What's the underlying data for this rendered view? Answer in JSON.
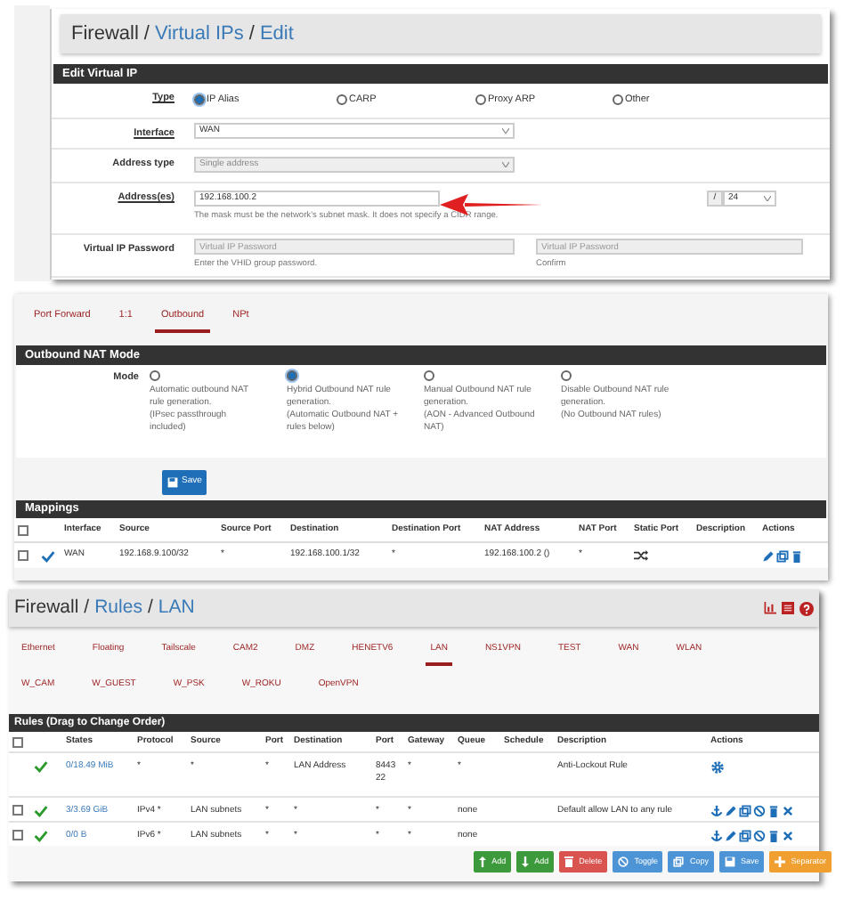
{
  "vip_edit": {
    "breadcrumb": [
      "Firewall",
      "Virtual IPs",
      "Edit"
    ],
    "breadcrumb_separator": "/",
    "section": "Edit Virtual IP",
    "type": {
      "label": "Type",
      "options": [
        {
          "label": "IP Alias",
          "selected": true
        },
        {
          "label": "CARP",
          "selected": false
        },
        {
          "label": "Proxy ARP",
          "selected": false
        },
        {
          "label": "Other",
          "selected": false
        }
      ]
    },
    "interface": {
      "label": "Interface",
      "value": "WAN"
    },
    "address_type": {
      "label": "Address type",
      "value": "Single address",
      "disabled": true
    },
    "addresses": {
      "label": "Address(es)",
      "value": "192.168.100.2",
      "separator": "/",
      "mask": "24",
      "hint": "The mask must be the network's subnet mask. It does not specify a CIDR range."
    },
    "vip_password": {
      "label": "Virtual IP Password",
      "placeholder": "Virtual IP Password",
      "hint": "Enter the VHID group password.",
      "confirm_placeholder": "Virtual IP Password",
      "confirm_hint": "Confirm"
    }
  },
  "nat_outbound": {
    "tabs": [
      {
        "label": "Port Forward",
        "selected": false
      },
      {
        "label": "1:1",
        "selected": false
      },
      {
        "label": "Outbound",
        "selected": true
      },
      {
        "label": "NPt",
        "selected": false
      }
    ],
    "mode_section": "Outbound NAT Mode",
    "mode_label": "Mode",
    "modes": [
      {
        "selected": false,
        "lines": [
          "Automatic outbound NAT rule generation.",
          "(IPsec passthrough included)"
        ]
      },
      {
        "selected": true,
        "lines": [
          "Hybrid Outbound NAT rule generation.",
          "(Automatic Outbound NAT + rules below)"
        ]
      },
      {
        "selected": false,
        "lines": [
          "Manual Outbound NAT rule generation.",
          "(AON - Advanced Outbound NAT)"
        ]
      },
      {
        "selected": false,
        "lines": [
          "Disable Outbound NAT rule generation.",
          "(No Outbound NAT rules)"
        ]
      }
    ],
    "save_button": "Save",
    "mappings_section": "Mappings",
    "select_all_checked": false,
    "columns": [
      "Interface",
      "Source",
      "Source Port",
      "Destination",
      "Destination Port",
      "NAT Address",
      "NAT Port",
      "Static Port",
      "Description",
      "Actions"
    ],
    "rows": [
      {
        "checked": false,
        "enabled": true,
        "interface": "WAN",
        "source": "192.168.9.100/32",
        "source_port": "*",
        "destination": "192.168.100.1/32",
        "destination_port": "*",
        "nat_address": "192.168.100.2 ()",
        "nat_port": "*",
        "static_port": true,
        "actions": [
          {
            "kind": "edit"
          },
          {
            "kind": "copy"
          },
          {
            "kind": "delete"
          }
        ]
      }
    ]
  },
  "rules_lan": {
    "breadcrumb": [
      "Firewall",
      "Rules",
      "LAN"
    ],
    "breadcrumb_separator": "/",
    "tabs": [
      {
        "label": "Ethernet",
        "selected": false
      },
      {
        "label": "Floating",
        "selected": false
      },
      {
        "label": "Tailscale",
        "selected": false
      },
      {
        "label": "CAM2",
        "selected": false
      },
      {
        "label": "DMZ",
        "selected": false
      },
      {
        "label": "HENETV6",
        "selected": false
      },
      {
        "label": "LAN",
        "selected": true
      },
      {
        "label": "NS1VPN",
        "selected": false
      },
      {
        "label": "TEST",
        "selected": false
      },
      {
        "label": "WAN",
        "selected": false
      },
      {
        "label": "WLAN",
        "selected": false
      },
      {
        "label": "W_CAM",
        "selected": false
      },
      {
        "label": "W_GUEST",
        "selected": false
      },
      {
        "label": "W_PSK",
        "selected": false
      },
      {
        "label": "W_ROKU",
        "selected": false
      },
      {
        "label": "OpenVPN",
        "selected": false
      }
    ],
    "section": "Rules (Drag to Change Order)",
    "select_all_checked": false,
    "columns": [
      "States",
      "Protocol",
      "Source",
      "Port",
      "Destination",
      "Port",
      "Gateway",
      "Queue",
      "Schedule",
      "Description",
      "Actions"
    ],
    "rows": [
      {
        "has_checkbox": false,
        "enabled": true,
        "states": "0/18.49 MiB",
        "protocol": "*",
        "source": "*",
        "source_port": "*",
        "destination": "LAN Address",
        "destination_port": "8443 22",
        "gateway": "*",
        "queue": "*",
        "description": "Anti-Lockout Rule",
        "actions": [
          {
            "kind": "settings"
          }
        ]
      },
      {
        "has_checkbox": true,
        "enabled": true,
        "states": "3/3.69 GiB",
        "protocol": "IPv4 *",
        "source": "LAN subnets",
        "source_port": "*",
        "destination": "*",
        "destination_port": "*",
        "gateway": "*",
        "queue": "none",
        "description": "Default allow LAN to any rule",
        "actions": [
          {
            "kind": "anchor"
          },
          {
            "kind": "edit"
          },
          {
            "kind": "copy"
          },
          {
            "kind": "block"
          },
          {
            "kind": "delete"
          },
          {
            "kind": "close"
          }
        ]
      },
      {
        "has_checkbox": true,
        "enabled": true,
        "states": "0/0 B",
        "protocol": "IPv6 *",
        "source": "LAN subnets",
        "source_port": "*",
        "destination": "*",
        "destination_port": "*",
        "gateway": "*",
        "queue": "none",
        "actions": [
          {
            "kind": "anchor"
          },
          {
            "kind": "edit"
          },
          {
            "kind": "copy"
          },
          {
            "kind": "block"
          },
          {
            "kind": "delete"
          },
          {
            "kind": "close"
          }
        ]
      }
    ],
    "buttons": [
      {
        "kind": "add_top",
        "label": "Add"
      },
      {
        "kind": "add_bottom",
        "label": "Add"
      },
      {
        "kind": "delete",
        "label": "Delete"
      },
      {
        "kind": "toggle",
        "label": "Toggle"
      },
      {
        "kind": "copy",
        "label": "Copy"
      },
      {
        "kind": "save",
        "label": "Save"
      },
      {
        "kind": "separator",
        "label": "Separator"
      }
    ]
  }
}
